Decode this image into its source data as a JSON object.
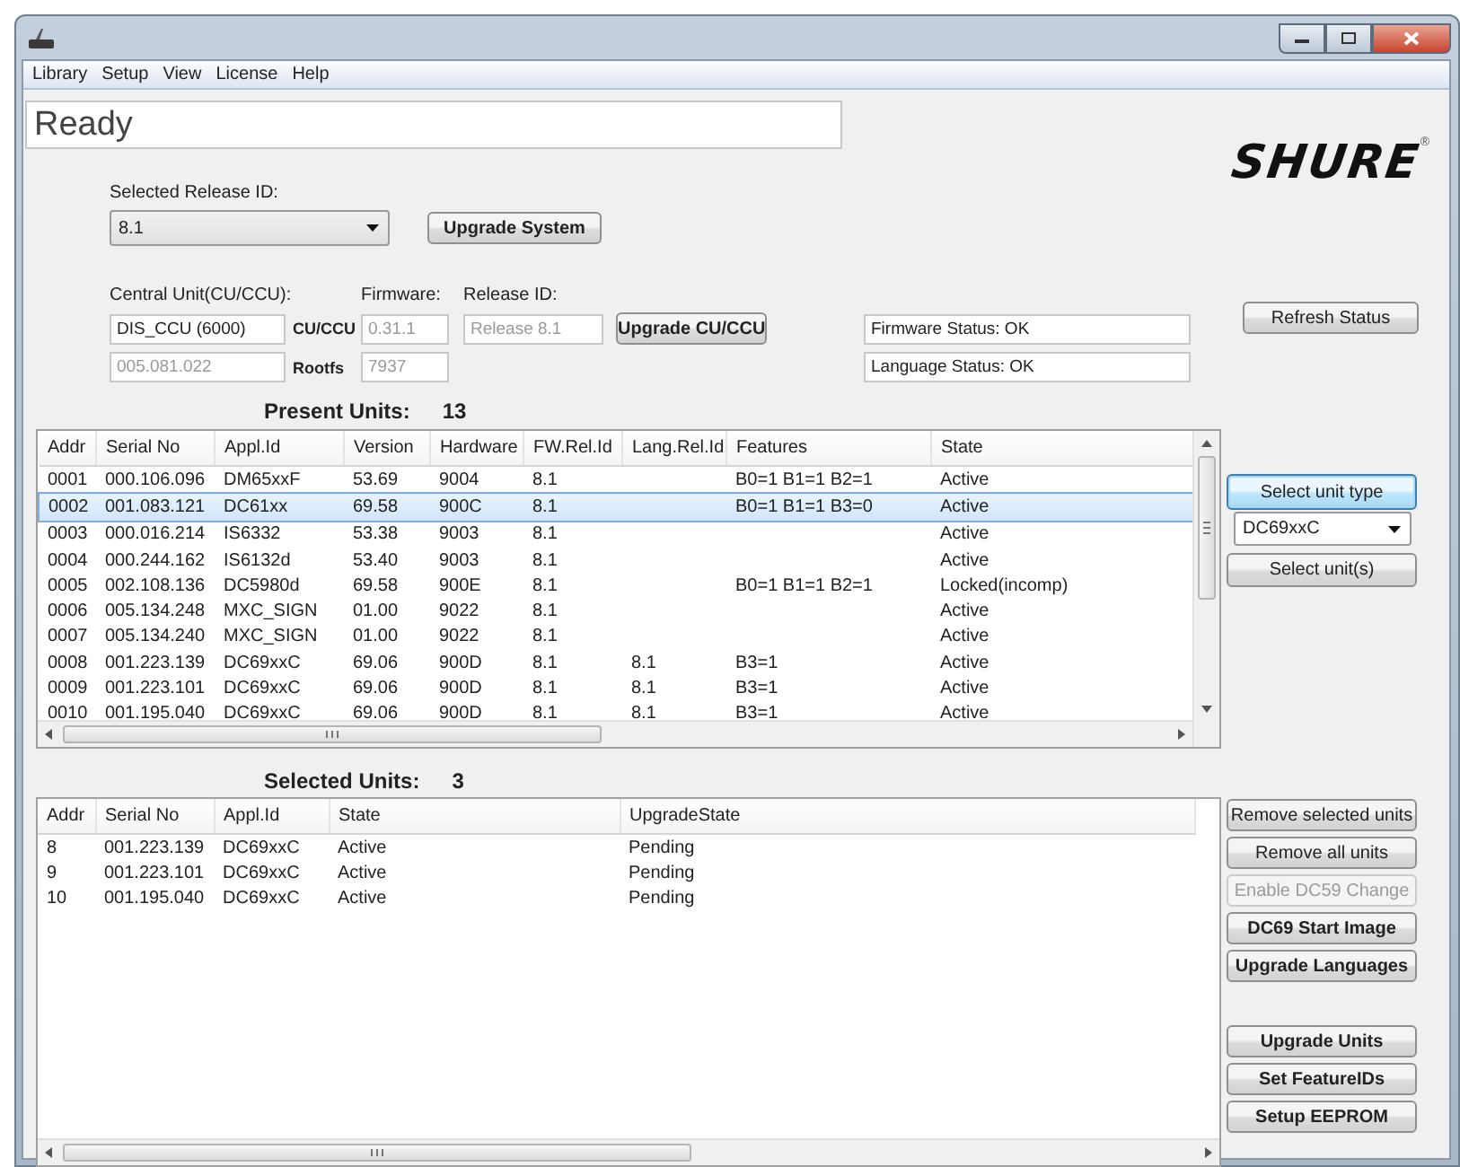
{
  "menu": [
    "Library",
    "Setup",
    "View",
    "License",
    "Help"
  ],
  "status": "Ready",
  "logo": {
    "text": "SHURE",
    "mark": "®"
  },
  "release": {
    "label": "Selected Release ID:",
    "value": "8.1",
    "button": "Upgrade System"
  },
  "central_unit": {
    "label": "Central Unit(CU/CCU):",
    "firmware_label": "Firmware:",
    "release_label": "Release ID:",
    "name": {
      "value": "DIS_CCU (6000)",
      "disabled": false
    },
    "serial": {
      "value": "005.081.022",
      "disabled": true
    },
    "cu_label": "CU/CCU",
    "cu_firmware": {
      "value": "0.31.1",
      "disabled": true
    },
    "rootfs_label": "Rootfs",
    "rootfs": {
      "value": "7937",
      "disabled": true
    },
    "release_id": {
      "value": "Release 8.1",
      "disabled": true
    },
    "button": "Upgrade CU/CCU"
  },
  "status_fields": [
    "Firmware Status: OK",
    "Language Status: OK"
  ],
  "refresh_button": "Refresh Status",
  "present_units": {
    "label": "Present Units:",
    "count": "13",
    "columns": [
      "Addr",
      "Serial No",
      "Appl.Id",
      "Version",
      "Hardware",
      "FW.Rel.Id",
      "Lang.Rel.Id",
      "Features",
      "State"
    ],
    "rows": [
      {
        "cells": [
          "0001",
          "000.106.096",
          "DM65xxF",
          "53.69",
          "9004",
          "8.1",
          "",
          "B0=1 B1=1 B2=1",
          "Active"
        ],
        "selected": false
      },
      {
        "cells": [
          "0002",
          "001.083.121",
          "DC61xx",
          "69.58",
          "900C",
          "8.1",
          "",
          "B0=1 B1=1 B3=0",
          "Active"
        ],
        "selected": true
      },
      {
        "cells": [
          "0003",
          "000.016.214",
          "IS6332",
          "53.38",
          "9003",
          "8.1",
          "",
          "",
          "Active"
        ],
        "selected": false
      },
      {
        "cells": [
          "0004",
          "000.244.162",
          "IS6132d",
          "53.40",
          "9003",
          "8.1",
          "",
          "",
          "Active"
        ],
        "selected": false
      },
      {
        "cells": [
          "0005",
          "002.108.136",
          "DC5980d",
          "69.58",
          "900E",
          "8.1",
          "",
          "B0=1 B1=1 B2=1",
          "Locked(incomp)"
        ],
        "selected": false
      },
      {
        "cells": [
          "0006",
          "005.134.248",
          "MXC_SIGN",
          "01.00",
          "9022",
          "8.1",
          "",
          "",
          "Active"
        ],
        "selected": false
      },
      {
        "cells": [
          "0007",
          "005.134.240",
          "MXC_SIGN",
          "01.00",
          "9022",
          "8.1",
          "",
          "",
          "Active"
        ],
        "selected": false
      },
      {
        "cells": [
          "0008",
          "001.223.139",
          "DC69xxC",
          "69.06",
          "900D",
          "8.1",
          "8.1",
          "B3=1",
          "Active"
        ],
        "selected": false
      },
      {
        "cells": [
          "0009",
          "001.223.101",
          "DC69xxC",
          "69.06",
          "900D",
          "8.1",
          "8.1",
          "B3=1",
          "Active"
        ],
        "selected": false
      },
      {
        "cells": [
          "0010",
          "001.195.040",
          "DC69xxC",
          "69.06",
          "900D",
          "8.1",
          "8.1",
          "B3=1",
          "Active"
        ],
        "selected": false
      }
    ]
  },
  "unit_selection": {
    "type_button": {
      "label": "Select unit type",
      "focused": true
    },
    "type_value": "DC69xxC",
    "select_button": "Select unit(s)"
  },
  "selected_units": {
    "label": "Selected Units:",
    "count": "3",
    "columns": [
      "Addr",
      "Serial No",
      "Appl.Id",
      "State",
      "UpgradeState"
    ],
    "rows": [
      [
        "8",
        "001.223.139",
        "DC69xxC",
        "Active",
        "Pending"
      ],
      [
        "9",
        "001.223.101",
        "DC69xxC",
        "Active",
        "Pending"
      ],
      [
        "10",
        "001.195.040",
        "DC69xxC",
        "Active",
        "Pending"
      ]
    ]
  },
  "action_groups": [
    {
      "buttons": [
        {
          "label": "Remove selected units",
          "kind": "plain",
          "disabled": false
        },
        {
          "label": "Remove all units",
          "kind": "plain",
          "disabled": false
        },
        {
          "label": "Enable DC59 Change",
          "kind": "plain",
          "disabled": true
        },
        {
          "label": "DC69 Start Image",
          "kind": "strong",
          "disabled": false
        },
        {
          "label": "Upgrade Languages",
          "kind": "strong",
          "disabled": false
        }
      ]
    },
    {
      "buttons": [
        {
          "label": "Upgrade Units",
          "kind": "strong",
          "disabled": false
        },
        {
          "label": "Set FeatureIDs",
          "kind": "strong",
          "disabled": false
        },
        {
          "label": "Setup EEPROM",
          "kind": "strong",
          "disabled": false
        }
      ]
    }
  ]
}
